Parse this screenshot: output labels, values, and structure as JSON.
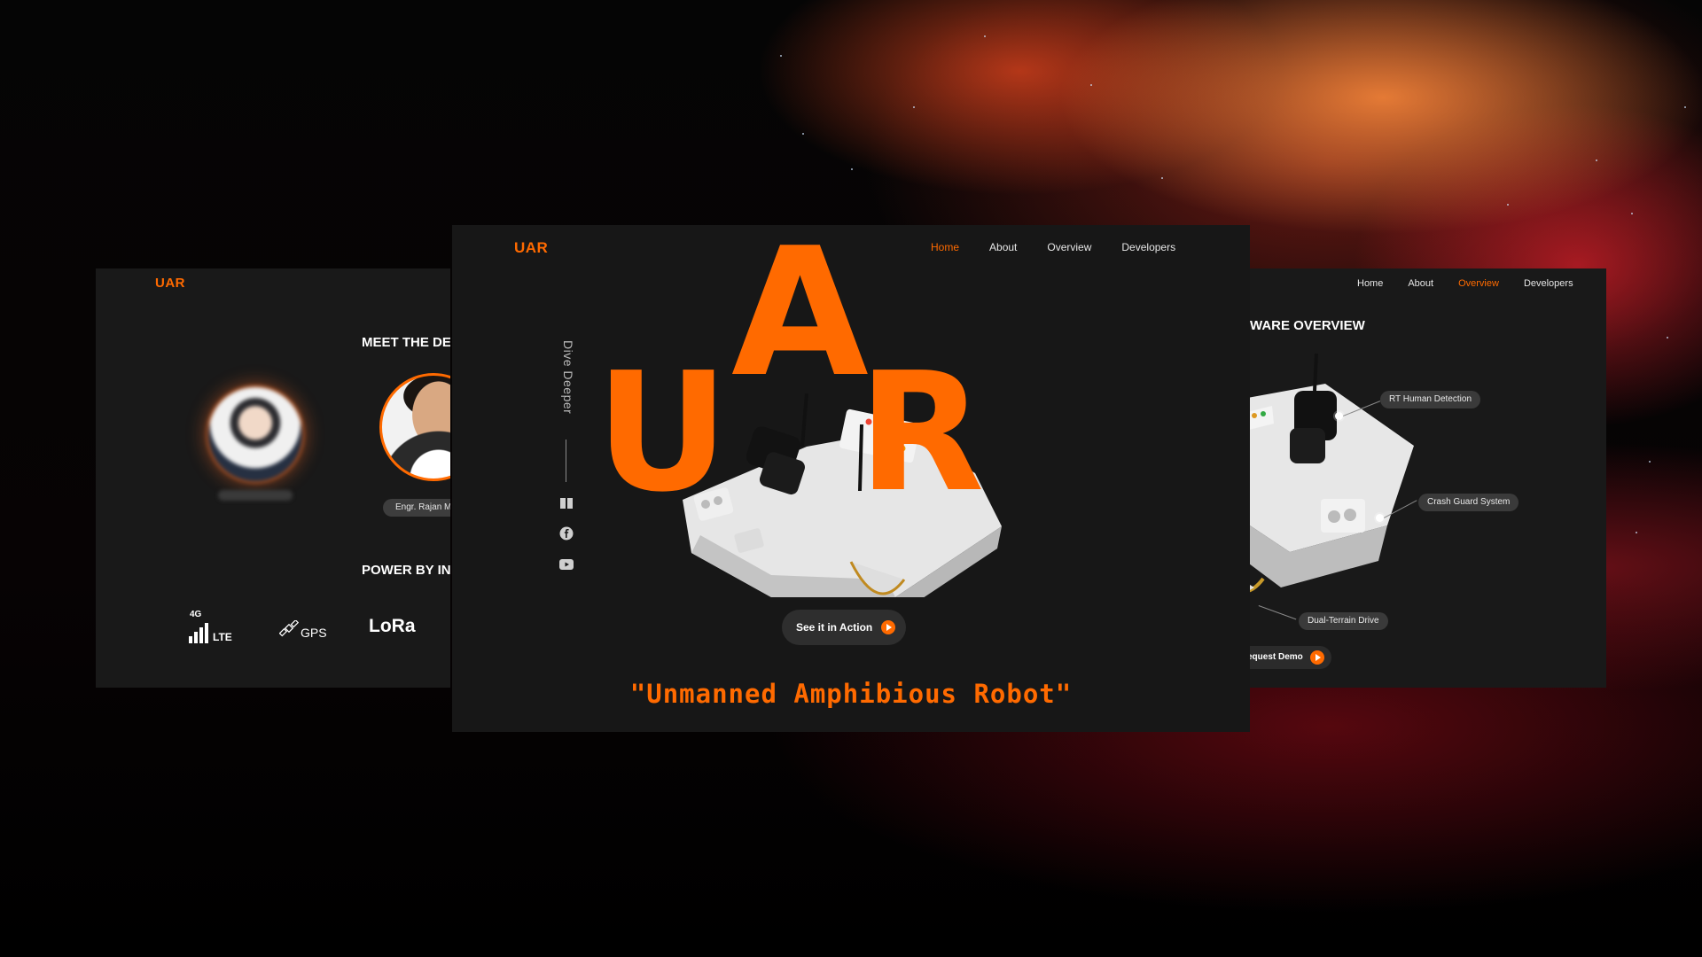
{
  "left_window": {
    "brand": "UAR",
    "heading_devs": "MEET THE DEV",
    "developer_2_name": "Engr. Rajan M",
    "heading_power": "POWER BY INN",
    "tech": {
      "lte_super": "4G",
      "lte": "LTE",
      "gps": "GPS",
      "lora": "LoRa"
    }
  },
  "center_window": {
    "brand": "UAR",
    "nav": [
      {
        "label": "Home",
        "active": true
      },
      {
        "label": "About",
        "active": false
      },
      {
        "label": "Overview",
        "active": false
      },
      {
        "label": "Developers",
        "active": false
      }
    ],
    "dive_deeper": "Dive Deeper",
    "hero_letters": {
      "first": "U",
      "second": "A",
      "third": "R"
    },
    "action_label": "See it in Action",
    "tagline": "\"Unmanned Amphibious Robot\"",
    "side_icons": [
      "book-icon",
      "facebook-icon",
      "youtube-icon"
    ]
  },
  "right_window": {
    "nav": [
      {
        "label": "Home",
        "active": false
      },
      {
        "label": "About",
        "active": false
      },
      {
        "label": "Overview",
        "active": true
      },
      {
        "label": "Developers",
        "active": false
      }
    ],
    "heading": "WARE OVERVIEW",
    "callouts": {
      "human": "RT Human Detection",
      "crash": "Crash Guard System",
      "drive": "Dual-Terrain Drive"
    },
    "demo_label": "equest Demo"
  },
  "colors": {
    "accent": "#ff6a00",
    "window_bg": "#181818"
  }
}
